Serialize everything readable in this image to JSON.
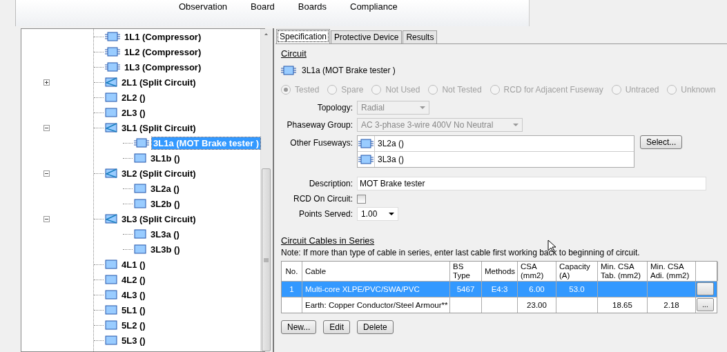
{
  "toolbar": {
    "buttons": [
      "Observation",
      "Board",
      "Boards",
      "Compliance"
    ]
  },
  "tree": {
    "items": [
      {
        "label": "1L1 (Compressor)",
        "kind": "fuseway",
        "selected": false
      },
      {
        "label": "1L2 (Compressor)",
        "kind": "fuseway",
        "selected": false
      },
      {
        "label": "1L3 (Compressor)",
        "kind": "fuseway",
        "selected": false
      },
      {
        "label": "2L1 (Split Circuit)",
        "kind": "split",
        "selected": false,
        "expanded": false
      },
      {
        "label": "2L2 ()",
        "kind": "plain",
        "selected": false
      },
      {
        "label": "2L3 ()",
        "kind": "plain",
        "selected": false
      },
      {
        "label": "3L1 (Split Circuit)",
        "kind": "split",
        "selected": false,
        "expanded": true,
        "children": [
          {
            "label": "3L1a (MOT Brake tester )",
            "kind": "fuseway",
            "selected": true
          },
          {
            "label": "3L1b ()",
            "kind": "plain",
            "selected": false
          }
        ]
      },
      {
        "label": "3L2 (Split Circuit)",
        "kind": "split",
        "selected": false,
        "expanded": true,
        "children": [
          {
            "label": "3L2a ()",
            "kind": "plain",
            "selected": false
          },
          {
            "label": "3L2b ()",
            "kind": "plain",
            "selected": false
          }
        ]
      },
      {
        "label": "3L3 (Split Circuit)",
        "kind": "split",
        "selected": false,
        "expanded": true,
        "children": [
          {
            "label": "3L3a ()",
            "kind": "plain",
            "selected": false
          },
          {
            "label": "3L3b ()",
            "kind": "plain",
            "selected": false
          }
        ]
      },
      {
        "label": "4L1 ()",
        "kind": "plain",
        "selected": false
      },
      {
        "label": "4L2 ()",
        "kind": "plain",
        "selected": false
      },
      {
        "label": "4L3 ()",
        "kind": "plain",
        "selected": false
      },
      {
        "label": "5L1 ()",
        "kind": "plain",
        "selected": false
      },
      {
        "label": "5L2 ()",
        "kind": "plain",
        "selected": false
      },
      {
        "label": "5L3 ()",
        "kind": "plain",
        "selected": false
      }
    ]
  },
  "tabs": [
    {
      "label": "Specification",
      "selected": true
    },
    {
      "label": "Protective Device",
      "selected": false
    },
    {
      "label": "Results",
      "selected": false
    }
  ],
  "circuit": {
    "heading": "Circuit",
    "name": "3L1a (MOT Brake tester )",
    "status_disabled": true,
    "status_options": [
      {
        "label": "Tested",
        "selected": true
      },
      {
        "label": "Spare",
        "selected": false
      },
      {
        "label": "Not Used",
        "selected": false
      },
      {
        "label": "Not Tested",
        "selected": false
      },
      {
        "label": "RCD for Adjacent Fuseway",
        "selected": false
      },
      {
        "label": "Untraced",
        "selected": false
      },
      {
        "label": "Unknown",
        "selected": false
      }
    ],
    "topology": {
      "label": "Topology:",
      "value": "Radial",
      "disabled": true
    },
    "phaseway_group": {
      "label": "Phaseway Group:",
      "value": "AC 3-phase 3-wire 400V No Neutral",
      "disabled": true
    },
    "other_fuseways": {
      "label": "Other Fuseways:",
      "items": [
        "3L2a ()",
        "3L3a ()"
      ],
      "button": "Select..."
    },
    "description": {
      "label": "Description:",
      "value": "MOT Brake tester"
    },
    "rcd_on_circuit": {
      "label": "RCD On Circuit:",
      "checked": false
    },
    "points_served": {
      "label": "Points Served:",
      "value": "1.00"
    }
  },
  "cables": {
    "heading": "Circuit Cables in Series",
    "note": "Note: If more than type of cable in series, enter last cable first working back to beginning of circuit.",
    "columns": [
      "No.",
      "Cable",
      "BS Type",
      "Methods",
      "CSA (mm2)",
      "Capacity (A)",
      "Min. CSA Tab. (mm2)",
      "Min. CSA Adi. (mm2)"
    ],
    "rows": [
      {
        "selected": true,
        "cells": [
          "1",
          "Multi-core XLPE/PVC/SWA/PVC",
          "5467",
          "E4:3",
          "6.00",
          "53.0",
          "",
          ""
        ],
        "button": ""
      },
      {
        "selected": false,
        "cells": [
          "",
          "Earth: Copper Conductor/Steel Armour**",
          "",
          "",
          "23.00",
          "",
          "18.65",
          "2.18"
        ],
        "button": "..."
      }
    ],
    "buttons": [
      "New...",
      "Edit",
      "Delete"
    ]
  }
}
